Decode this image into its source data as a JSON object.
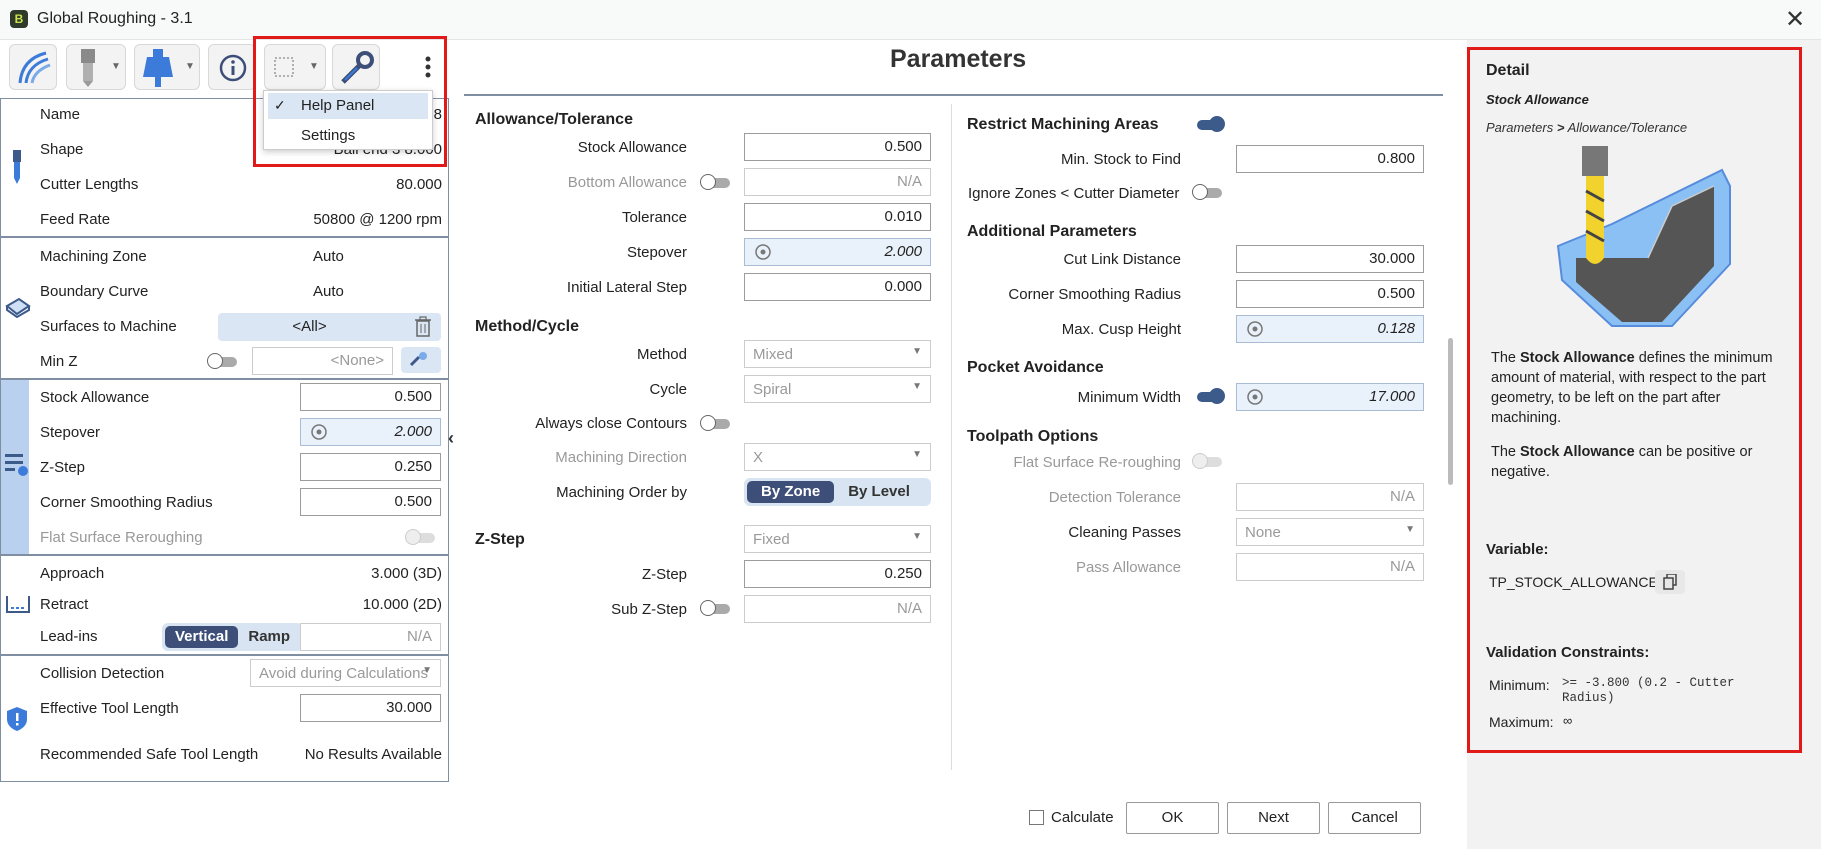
{
  "window": {
    "title": "Global Roughing - 3.1",
    "close": "✕",
    "app_icon": "B"
  },
  "toolbar": {
    "icons": [
      "roughing-icon",
      "tool-icon",
      "holder-icon",
      "info-icon",
      "panel-toggle-icon",
      "wrench-icon",
      "more-icon"
    ],
    "dropdown": {
      "items": [
        {
          "label": "Help Panel",
          "checked": true
        },
        {
          "label": "Settings",
          "checked": false
        }
      ],
      "check": "✓"
    }
  },
  "left": {
    "tool": {
      "rows": [
        {
          "label": "Name",
          "value": "8"
        },
        {
          "label": "Shape",
          "value": "Ball end 3 8.000"
        },
        {
          "label": "Cutter Lengths",
          "value": "80.000"
        },
        {
          "label": "Feed Rate",
          "value": "50800 @ 1200 rpm"
        }
      ]
    },
    "zone": {
      "machining_zone": {
        "label": "Machining Zone",
        "value": "Auto"
      },
      "boundary_curve": {
        "label": "Boundary Curve",
        "value": "Auto"
      },
      "surfaces": {
        "label": "Surfaces to Machine",
        "value": "<All>"
      },
      "min_z": {
        "label": "Min Z",
        "placeholder": "<None>"
      }
    },
    "params": {
      "stock_allowance": {
        "label": "Stock Allowance",
        "value": "0.500"
      },
      "stepover": {
        "label": "Stepover",
        "value": "2.000"
      },
      "z_step": {
        "label": "Z-Step",
        "value": "0.250"
      },
      "corner_smoothing": {
        "label": "Corner Smoothing Radius",
        "value": "0.500"
      },
      "flat_surface": {
        "label": "Flat Surface Reroughing"
      }
    },
    "links": {
      "approach": {
        "label": "Approach",
        "value": "3.000 (3D)"
      },
      "retract": {
        "label": "Retract",
        "value": "10.000 (2D)"
      },
      "leadins": {
        "label": "Lead-ins",
        "options": [
          "Vertical",
          "Ramp"
        ],
        "value": "N/A"
      }
    },
    "collision": {
      "detection": {
        "label": "Collision Detection",
        "value": "Avoid during Calculations"
      },
      "effective_length": {
        "label": "Effective Tool Length",
        "value": "30.000"
      },
      "recommended": {
        "label": "Recommended Safe Tool Length",
        "value": "No Results Available"
      }
    },
    "collapse": "‹"
  },
  "center": {
    "heading": "Parameters",
    "allowance": {
      "title": "Allowance/Tolerance",
      "stock_allowance": {
        "label": "Stock Allowance",
        "value": "0.500"
      },
      "bottom_allowance": {
        "label": "Bottom Allowance",
        "value": "N/A"
      },
      "tolerance": {
        "label": "Tolerance",
        "value": "0.010"
      },
      "stepover": {
        "label": "Stepover",
        "value": "2.000"
      },
      "initial_lateral": {
        "label": "Initial Lateral Step",
        "value": "0.000"
      }
    },
    "method": {
      "title": "Method/Cycle",
      "method": {
        "label": "Method",
        "value": "Mixed"
      },
      "cycle": {
        "label": "Cycle",
        "value": "Spiral"
      },
      "close_contours": {
        "label": "Always close Contours"
      },
      "direction": {
        "label": "Machining Direction",
        "value": "X"
      },
      "order": {
        "label": "Machining Order by",
        "options": [
          "By Zone",
          "By Level"
        ]
      }
    },
    "zstep": {
      "title": "Z-Step",
      "mode": "Fixed",
      "z_step": {
        "label": "Z-Step",
        "value": "0.250"
      },
      "sub_z_step": {
        "label": "Sub Z-Step",
        "value": "N/A"
      }
    },
    "restrict": {
      "title": "Restrict Machining Areas",
      "min_stock": {
        "label": "Min. Stock to Find",
        "value": "0.800"
      },
      "ignore_zones": {
        "label": "Ignore Zones < Cutter Diameter"
      }
    },
    "additional": {
      "title": "Additional Parameters",
      "cut_link": {
        "label": "Cut Link Distance",
        "value": "30.000"
      },
      "corner_smoothing": {
        "label": "Corner Smoothing Radius",
        "value": "0.500"
      },
      "max_cusp": {
        "label": "Max. Cusp Height",
        "value": "0.128"
      }
    },
    "pocket": {
      "title": "Pocket Avoidance",
      "min_width": {
        "label": "Minimum Width",
        "value": "17.000"
      }
    },
    "toolpath": {
      "title": "Toolpath Options",
      "flat_surface": {
        "label": "Flat Surface Re-roughing"
      },
      "detection_tol": {
        "label": "Detection Tolerance",
        "value": "N/A"
      },
      "cleaning": {
        "label": "Cleaning Passes",
        "value": "None"
      },
      "pass_allowance": {
        "label": "Pass Allowance",
        "value": "N/A"
      }
    },
    "footer": {
      "calculate": "Calculate",
      "ok": "OK",
      "next": "Next",
      "cancel": "Cancel"
    }
  },
  "detail": {
    "title": "Detail",
    "subtitle": "Stock Allowance",
    "path_a": "Parameters",
    "path_sep": ">",
    "path_b": "Allowance/Tolerance",
    "desc1_pre": "The ",
    "desc1_bold": "Stock Allowance",
    "desc1_post": " defines the minimum amount of material, with respect to the part geometry, to be left on the part after machining.",
    "desc2_pre": "The ",
    "desc2_bold": "Stock Allowance",
    "desc2_post": " can be positive or negative.",
    "variable_title": "Variable:",
    "variable": "TP_STOCK_ALLOWANCE",
    "validation_title": "Validation Constraints:",
    "min_label": "Minimum:",
    "min_value": ">= -3.800 (0.2 - Cutter Radius)",
    "max_label": "Maximum:",
    "max_value": "∞"
  },
  "colors": {
    "accent": "#3d4f79",
    "highlight": "#e11919",
    "calc_bg": "#e9f1fb",
    "section_bg": "#dbe6f4"
  }
}
